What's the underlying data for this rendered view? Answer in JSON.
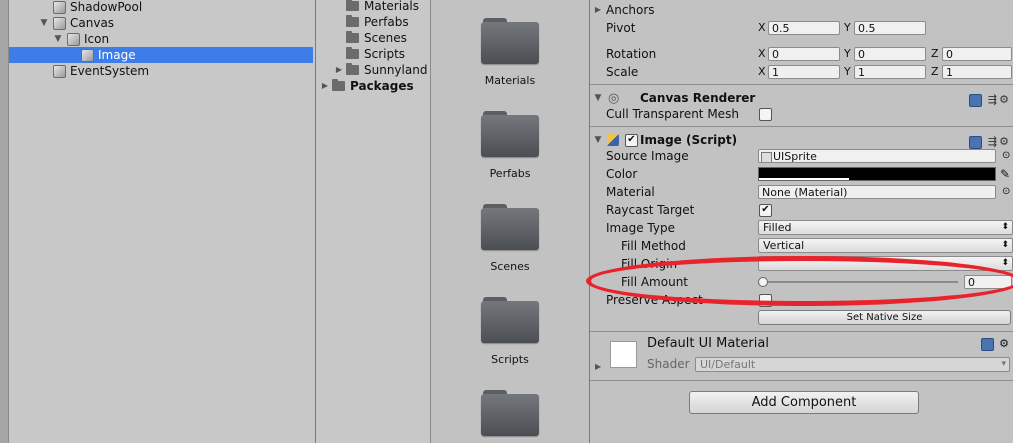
{
  "hierarchy": {
    "items": [
      {
        "label": "ShadowPool"
      },
      {
        "label": "Canvas"
      },
      {
        "label": "Icon"
      },
      {
        "label": "Image"
      },
      {
        "label": "EventSystem"
      }
    ]
  },
  "project": {
    "tree": [
      {
        "label": "Materials"
      },
      {
        "label": "Perfabs"
      },
      {
        "label": "Scenes"
      },
      {
        "label": "Scripts"
      },
      {
        "label": "Sunnyland"
      },
      {
        "label": "Packages"
      }
    ],
    "grid": [
      {
        "label": "Materials"
      },
      {
        "label": "Perfabs"
      },
      {
        "label": "Scenes"
      },
      {
        "label": "Scripts"
      },
      {
        "label": ""
      }
    ]
  },
  "inspector": {
    "rect_transform": {
      "anchors_label": "Anchors",
      "pivot_label": "Pivot",
      "pivot_x": "0.5",
      "pivot_y": "0.5",
      "rotation_label": "Rotation",
      "rot_x": "0",
      "rot_y": "0",
      "rot_z": "0",
      "scale_label": "Scale",
      "scale_x": "1",
      "scale_y": "1",
      "scale_z": "1",
      "axis_x": "X",
      "axis_y": "Y",
      "axis_z": "Z"
    },
    "canvas_renderer": {
      "title": "Canvas Renderer",
      "cull_label": "Cull Transparent Mesh",
      "cull_checked": false
    },
    "image": {
      "title": "Image (Script)",
      "source_image_label": "Source Image",
      "source_image_value": "UISprite",
      "color_label": "Color",
      "color_value": "#000000",
      "material_label": "Material",
      "material_value": "None (Material)",
      "raycast_label": "Raycast Target",
      "raycast_checked": "✔",
      "image_type_label": "Image Type",
      "image_type_value": "Filled",
      "fill_method_label": "Fill Method",
      "fill_method_value": "Vertical",
      "fill_origin_label": "Fill Origin",
      "fill_origin_value": "",
      "fill_amount_label": "Fill Amount",
      "fill_amount_value": "0",
      "preserve_label": "Preserve Aspect",
      "native_size_button": "Set Native Size"
    },
    "material_preview": {
      "name": "Default UI Material",
      "shader_label": "Shader",
      "shader_value": "UI/Default"
    },
    "add_component": "Add Component"
  },
  "colors": {
    "selection": "#3e7de7",
    "annotation": "#e8232b"
  }
}
